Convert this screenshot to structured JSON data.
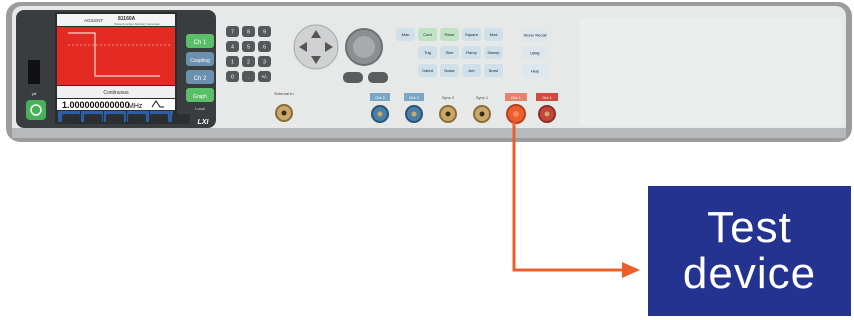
{
  "instrument": {
    "brand": "AGILENT",
    "model": "81160A",
    "subtitle": "Pulse Function Arbitrary Generator",
    "screen": {
      "modes": "Continuous",
      "freq_value": "1.000000000000",
      "freq_unit": "MHz",
      "softkeys": [
        "Frequency",
        "Amplitude",
        "Offset",
        "Width",
        "Delay"
      ]
    },
    "channel_buttons": [
      "Ch 1",
      "Coupling",
      "Ch 2",
      "Graph"
    ],
    "local_label": "Local",
    "keypad": [
      "7",
      "8",
      "9",
      "4",
      "5",
      "6",
      "1",
      "2",
      "3",
      "0",
      ".",
      "+/-"
    ],
    "function_keys": [
      "Man",
      "Cont",
      "Pulse",
      "Square",
      "Mod",
      "Trig",
      "Sine",
      "Ramp",
      "Sweep",
      "Gated",
      "Noise",
      "Arb",
      "Burst"
    ],
    "utility_keys": [
      "Store/ Recall",
      "Utility",
      "Help"
    ],
    "connectors": [
      "External In",
      "Out 2",
      "Out 2",
      "Sync 2",
      "Sync 1",
      "Out 1",
      "Out 1"
    ],
    "lxi_logo": "LXI"
  },
  "target": {
    "label_line1": "Test",
    "label_line2": "device"
  },
  "colors": {
    "body": "#e6e6e6",
    "front_panel": "#f2f2f2",
    "screen_red": "#e32b23",
    "arrow": "#ec5f2c",
    "target_box": "#23338f"
  }
}
